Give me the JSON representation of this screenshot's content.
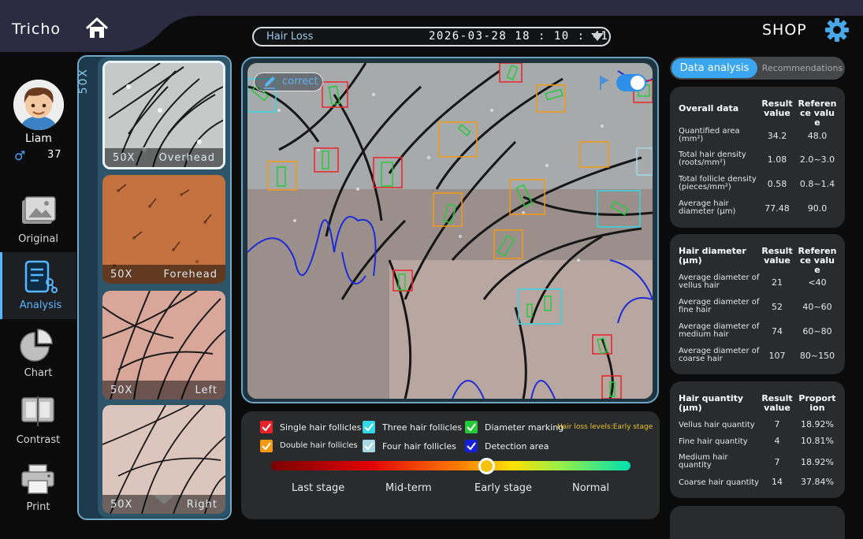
{
  "app": {
    "brand": "Tricho",
    "shop": "SHOP"
  },
  "header": {
    "mode": "Hair Loss",
    "datetime": "2026-03-28 18 : 10 : 41"
  },
  "user": {
    "name": "Liam",
    "gender_symbol": "♂",
    "age": "37"
  },
  "nav": [
    {
      "label": "Original",
      "icon": "image-icon"
    },
    {
      "label": "Analysis",
      "icon": "analysis-icon",
      "active": true
    },
    {
      "label": "Chart",
      "icon": "pie-chart-icon"
    },
    {
      "label": "Contrast",
      "icon": "contrast-icon"
    },
    {
      "label": "Print",
      "icon": "printer-icon"
    }
  ],
  "thumbnails": {
    "magnification": "50X",
    "items": [
      {
        "mag": "50X",
        "region": "Overhead",
        "selected": true
      },
      {
        "mag": "50X",
        "region": "Forehead"
      },
      {
        "mag": "50X",
        "region": "Left"
      },
      {
        "mag": "50X",
        "region": "Right"
      }
    ]
  },
  "image": {
    "correct_label": "correct",
    "detection_toggle": true
  },
  "legend": {
    "items": [
      {
        "label": "Single hair follicles",
        "color": "#e8242a"
      },
      {
        "label": "Three hair follicles",
        "color": "#35d6e8"
      },
      {
        "label": "Diameter marking",
        "color": "#27c93b"
      },
      {
        "label": "Double hair follicles",
        "color": "#f39a14"
      },
      {
        "label": "Four hair follicles",
        "color": "#a8d7e6"
      },
      {
        "label": "Detection area",
        "color": "#1320d8"
      }
    ],
    "loss_level": "Hair loss levels:Early stage",
    "stages": [
      "Last stage",
      "Mid-term",
      "Early stage",
      "Normal"
    ],
    "indicator_fraction": 0.6
  },
  "tabs": {
    "active": "Data analysis",
    "inactive": "Recommendations"
  },
  "overall": {
    "title": "Overall data",
    "col1": "Result value",
    "col2": "Reference value",
    "rows": [
      {
        "label": "Quantified area (mm²)",
        "value": "34.2",
        "ref": "48.0"
      },
      {
        "label": "Total hair density (roots/mm²)",
        "value": "1.08",
        "ref": "2.0~3.0"
      },
      {
        "label": "Total follicle density (pieces/mm²)",
        "value": "0.58",
        "ref": "0.8~1.4"
      },
      {
        "label": "Average hair diameter (µm)",
        "value": "77.48",
        "ref": "90.0"
      }
    ]
  },
  "diameter": {
    "title": "Hair diameter (µm)",
    "col1": "Result value",
    "col2": "Reference value",
    "rows": [
      {
        "label": "Average diameter of vellus hair",
        "value": "21",
        "ref": "<40"
      },
      {
        "label": "Average diameter of fine hair",
        "value": "52",
        "ref": "40~60"
      },
      {
        "label": "Average diameter of medium hair",
        "value": "74",
        "ref": "60~80"
      },
      {
        "label": "Average diameter of coarse hair",
        "value": "107",
        "ref": "80~150"
      }
    ]
  },
  "quantity": {
    "title": "Hair quantity (µm)",
    "col1": "Result value",
    "col2": "Proportion",
    "rows": [
      {
        "label": "Vellus hair quantity",
        "value": "7",
        "ref": "18.92%"
      },
      {
        "label": "Fine hair quantity",
        "value": "4",
        "ref": "10.81%"
      },
      {
        "label": "Medium hair quantity",
        "value": "7",
        "ref": "18.92%"
      },
      {
        "label": "Coarse hair quantity",
        "value": "14",
        "ref": "37.84%"
      }
    ]
  }
}
